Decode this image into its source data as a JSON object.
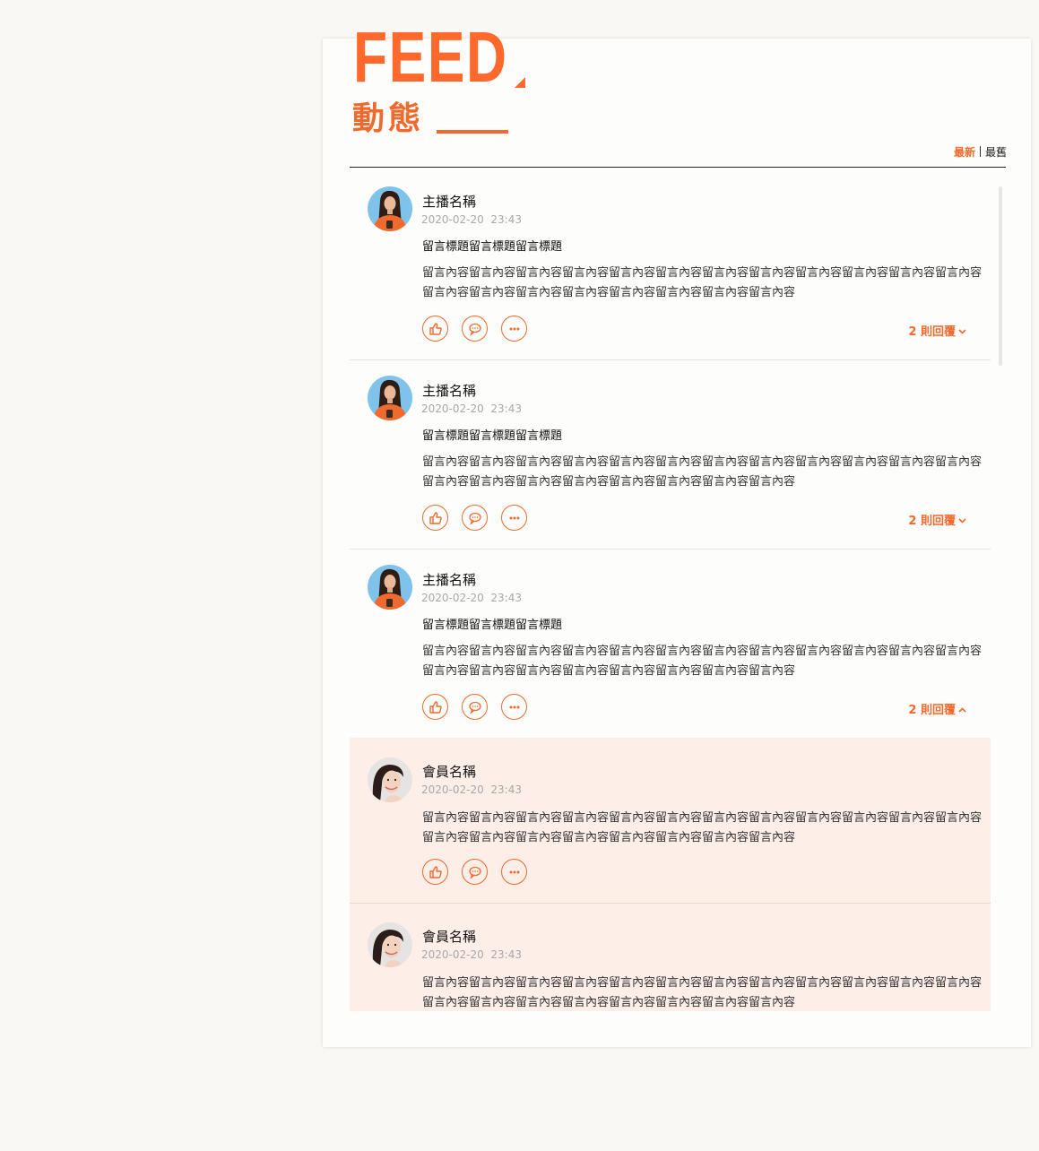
{
  "header": {
    "title": "FEED",
    "subtitle": "動態",
    "sort_newest": "最新",
    "sort_oldest": "最舊"
  },
  "colors": {
    "accent": "#f06a2e",
    "reply_bg": "#fdeee8"
  },
  "posts": [
    {
      "name": "主播名稱",
      "date": "2020-02-20",
      "time": "23:43",
      "title": "留言標題留言標題留言標題",
      "body": "留言內容留言內容留言內容留言內容留言內容留言內容留言內容留言內容留言內容留言內容留言內容留言內容留言內容留言內容留言內容留言內容留言內容留言內容留言內容留言內容",
      "replies_label": "2 則回覆",
      "replies_expanded": false
    },
    {
      "name": "主播名稱",
      "date": "2020-02-20",
      "time": "23:43",
      "title": "留言標題留言標題留言標題",
      "body": "留言內容留言內容留言內容留言內容留言內容留言內容留言內容留言內容留言內容留言內容留言內容留言內容留言內容留言內容留言內容留言內容留言內容留言內容留言內容留言內容",
      "replies_label": "2 則回覆",
      "replies_expanded": false
    },
    {
      "name": "主播名稱",
      "date": "2020-02-20",
      "time": "23:43",
      "title": "留言標題留言標題留言標題",
      "body": "留言內容留言內容留言內容留言內容留言內容留言內容留言內容留言內容留言內容留言內容留言內容留言內容留言內容留言內容留言內容留言內容留言內容留言內容留言內容留言內容",
      "replies_label": "2 則回覆",
      "replies_expanded": true
    }
  ],
  "replies": [
    {
      "name": "會員名稱",
      "date": "2020-02-20",
      "time": "23:43",
      "body": "留言內容留言內容留言內容留言內容留言內容留言內容留言內容留言內容留言內容留言內容留言內容留言內容留言內容留言內容留言內容留言內容留言內容留言內容留言內容留言內容"
    },
    {
      "name": "會員名稱",
      "date": "2020-02-20",
      "time": "23:43",
      "body": "留言內容留言內容留言內容留言內容留言內容留言內容留言內容留言內容留言內容留言內容留言內容留言內容留言內容留言內容留言內容留言內容留言內容留言內容留言內容留言內容"
    }
  ],
  "icons": {
    "like": "thumbs-up-icon",
    "comment": "speech-bubble-icon",
    "more": "ellipsis-icon",
    "collapse": "chevron-up-icon",
    "expand": "chevron-down-icon"
  }
}
